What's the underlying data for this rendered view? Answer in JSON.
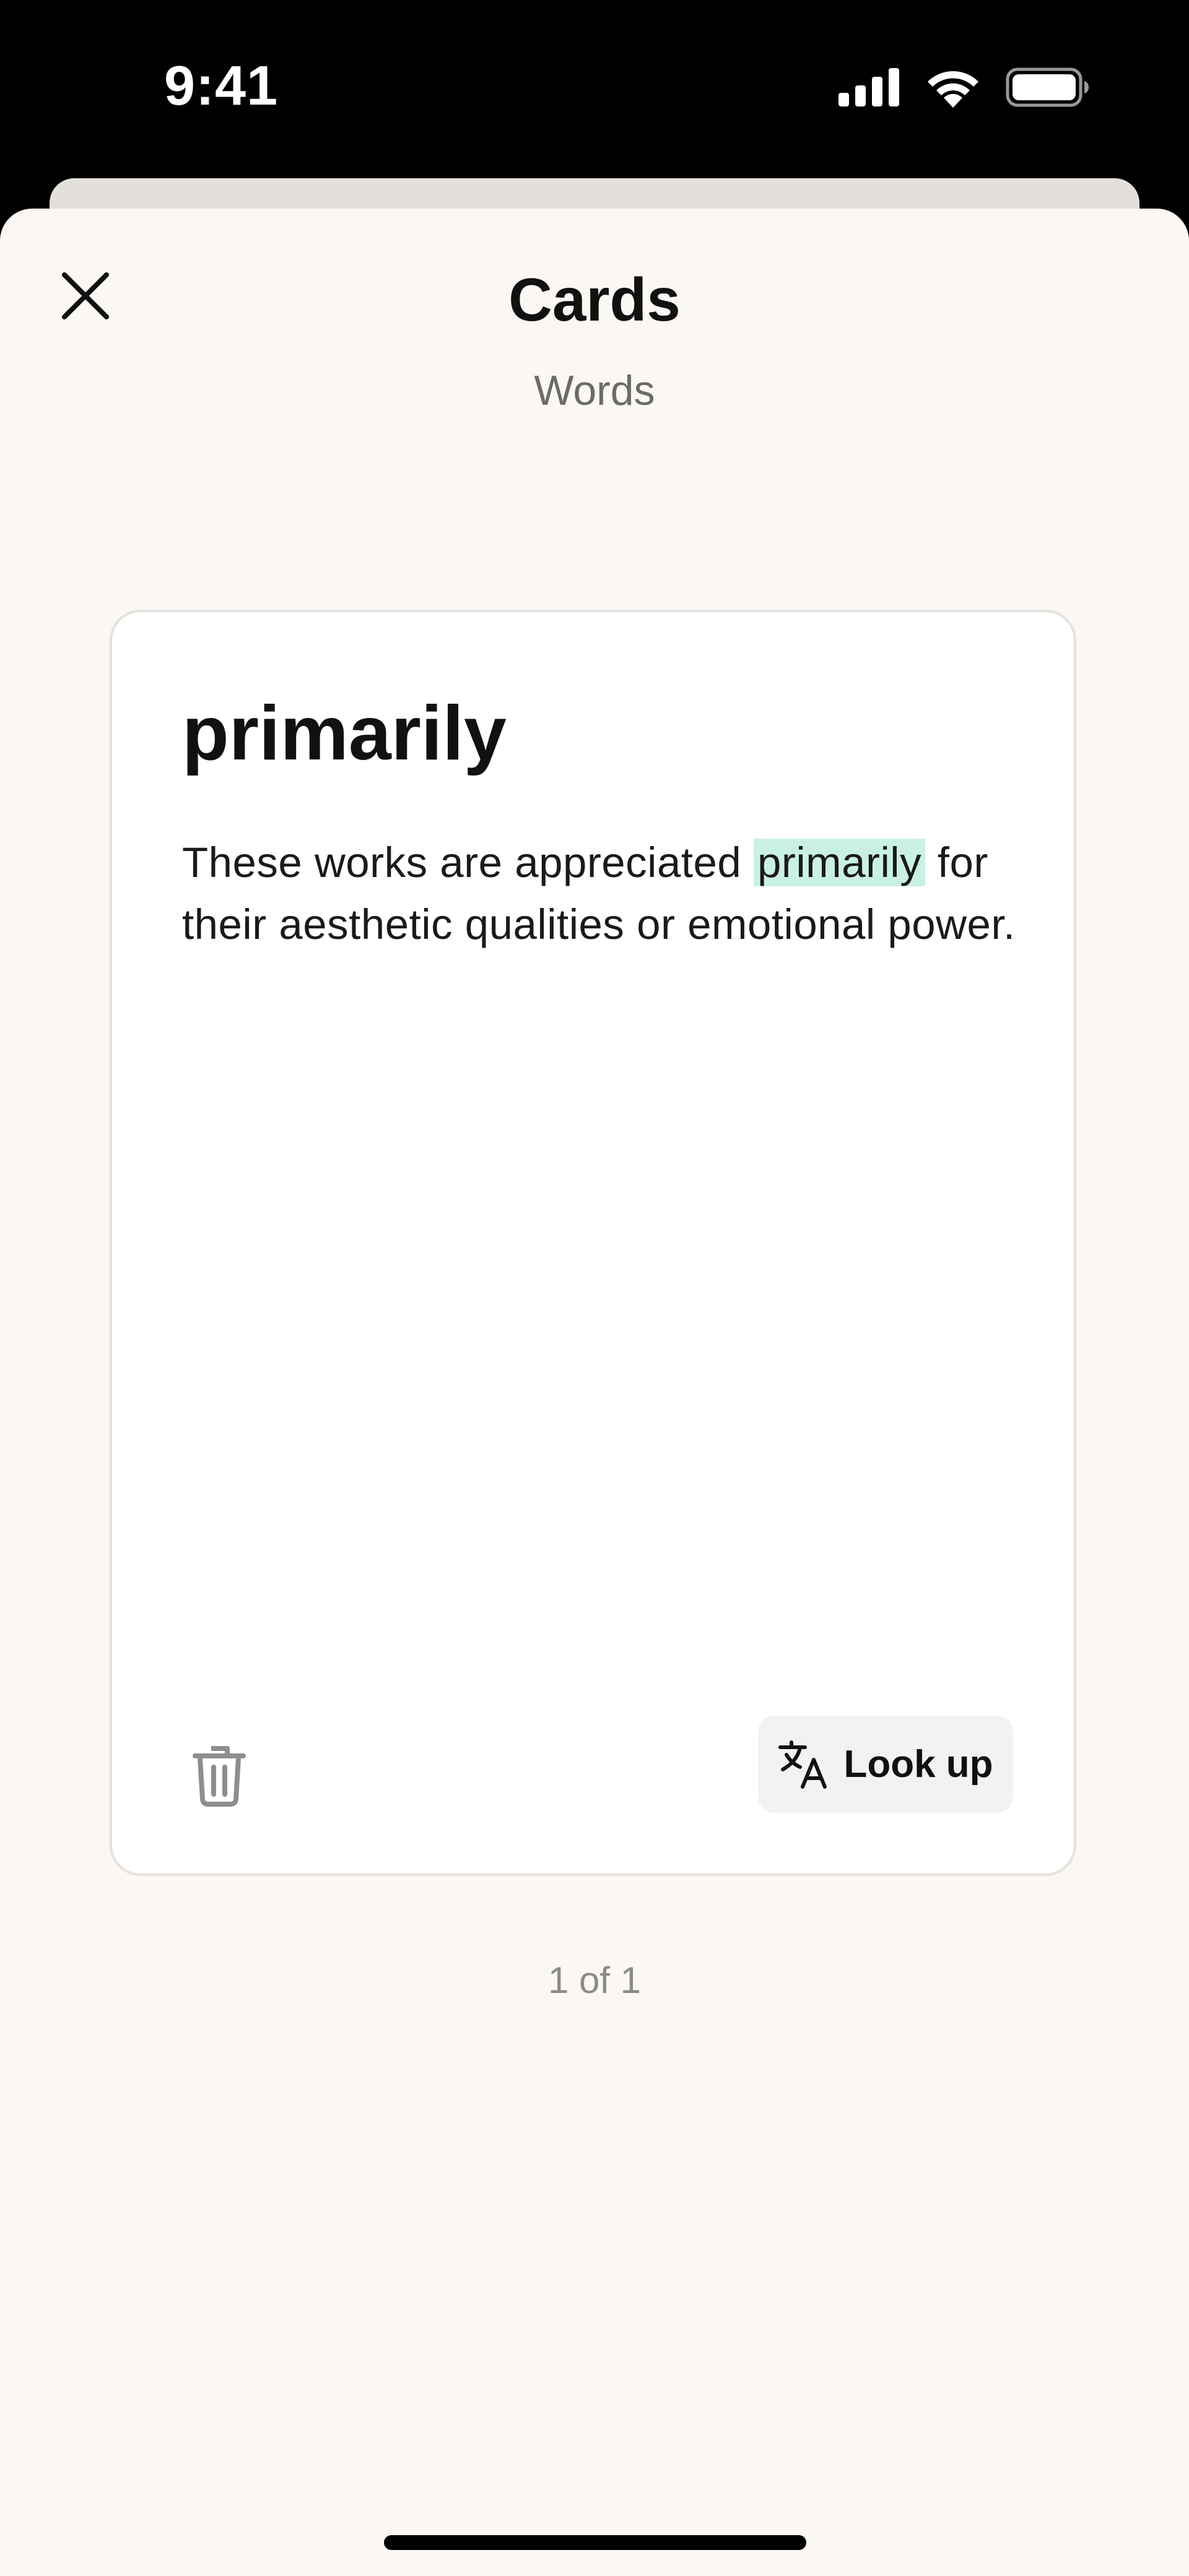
{
  "status_bar": {
    "time": "9:41",
    "icons": [
      "cellular-signal-icon",
      "wifi-icon",
      "battery-icon"
    ]
  },
  "header": {
    "title": "Cards",
    "subtitle": "Words",
    "close_icon": "close-icon"
  },
  "card": {
    "word": "primarily",
    "sentence_before": "These works are appreciated ",
    "sentence_highlight": "primarily",
    "sentence_after": " for their aesthetic qualities or emotional power.",
    "delete_icon": "trash-icon",
    "lookup_label": "Look up",
    "lookup_icon": "translate-icon"
  },
  "pager": {
    "text": "1 of 1"
  },
  "colors": {
    "sheet_background": "#fbf7f3",
    "card_background": "#ffffff",
    "highlight": "#c9f1e3",
    "button_background": "#f2f2f1"
  }
}
